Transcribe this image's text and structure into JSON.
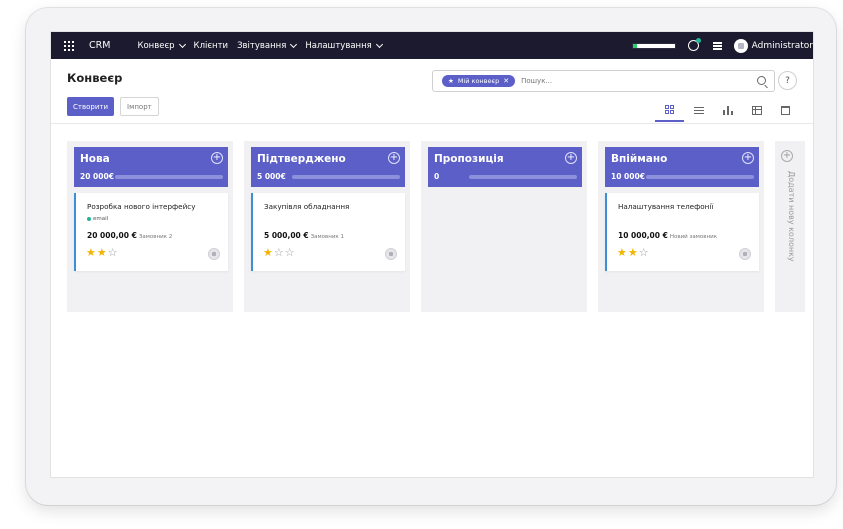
{
  "topnav": {
    "brand": "CRM",
    "menu": [
      {
        "label": "Конвеєр",
        "dropdown": true
      },
      {
        "label": "Клієнти",
        "dropdown": false
      },
      {
        "label": "Звітування",
        "dropdown": true
      },
      {
        "label": "Налаштування",
        "dropdown": true
      }
    ],
    "user_name": "Administrator",
    "progress_fraction": 0.1
  },
  "control": {
    "title": "Конвеєр",
    "create_label": "Створити",
    "import_label": "Імпорт",
    "search": {
      "facet_label": "Мій конвеєр",
      "facet_close": "✕",
      "placeholder": "Пошук..."
    },
    "help_label": "?",
    "views": [
      "kanban",
      "list",
      "graph",
      "pivot",
      "calendar"
    ],
    "active_view": "kanban"
  },
  "kanban": {
    "columns": [
      {
        "title": "Нова",
        "add": "+",
        "sum": "20 000",
        "currency": "€",
        "card": {
          "title": "Розробка нового інтерфейсу",
          "tag": "email",
          "amount": "20 000,00 €",
          "customer": "Замовник 2",
          "stars": 2
        }
      },
      {
        "title": "Підтверджено",
        "add": "+",
        "sum": "5 000",
        "currency": "€",
        "card": {
          "title": "Закупівля обладнання",
          "tag": "",
          "amount": "5 000,00 €",
          "customer": "Замовник 1",
          "stars": 1
        }
      },
      {
        "title": "Пропозиція",
        "add": "+",
        "sum": "0",
        "currency": ""
      },
      {
        "title": "Впіймано",
        "add": "+",
        "sum": "10 000",
        "currency": "€",
        "card": {
          "title": "Налаштування телефонії",
          "tag": "",
          "amount": "10 000,00 €",
          "customer": "Новий замовник",
          "stars": 2
        }
      }
    ],
    "add_column": {
      "icon": "+",
      "label": "Додати нову колонку"
    }
  },
  "colors": {
    "nav_bg": "#1b1a2e",
    "accent": "#5b5fc7",
    "card_border": "#3d8fd6",
    "tag_dot": "#25b49a",
    "star": "#f3b400",
    "progress": "#2ecc71"
  }
}
